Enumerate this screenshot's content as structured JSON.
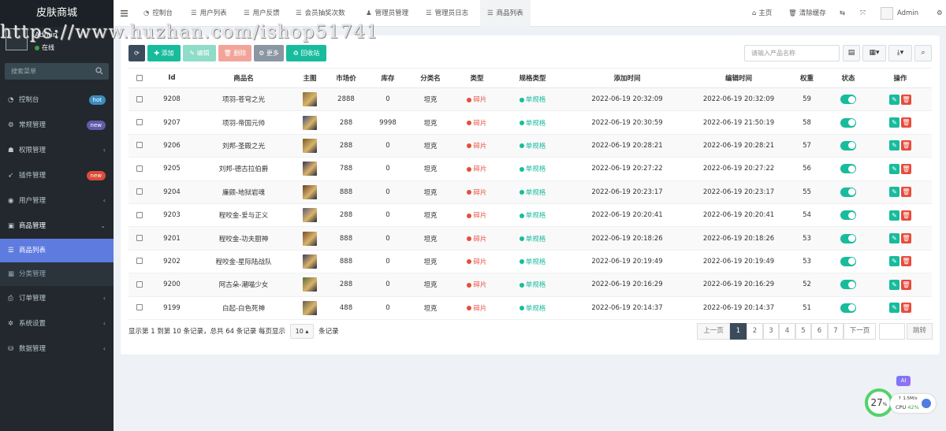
{
  "sidebar": {
    "brand": "皮肤商城",
    "user_name": "Admin",
    "user_status": "在线",
    "search_placeholder": "搜索菜单",
    "menu": [
      {
        "label": "控制台",
        "icon": "dashboard-icon",
        "badge": "hot",
        "badge_color": "#3c8dbc"
      },
      {
        "label": "常规管理",
        "icon": "cogs-icon",
        "badge": "new",
        "badge_color": "#605ca8"
      },
      {
        "label": "权限管理",
        "icon": "group-icon",
        "arrow": "‹"
      },
      {
        "label": "插件管理",
        "icon": "rocket-icon",
        "badge": "new",
        "badge_color": "#dd4b39"
      },
      {
        "label": "用户管理",
        "icon": "user-circle-icon",
        "arrow": "‹"
      },
      {
        "label": "商品管理",
        "icon": "cube-icon",
        "arrow": "⌄"
      }
    ],
    "submenu": [
      {
        "label": "商品列表",
        "icon": "list-icon"
      },
      {
        "label": "分类管理",
        "icon": "grid-icon"
      }
    ],
    "menu2": [
      {
        "label": "订单管理",
        "icon": "print-icon",
        "arrow": "‹"
      },
      {
        "label": "系统设置",
        "icon": "gear-icon",
        "arrow": "‹"
      },
      {
        "label": "数据管理",
        "icon": "database-icon",
        "arrow": "‹"
      }
    ]
  },
  "header": {
    "tabs": [
      "控制台",
      "用户列表",
      "用户反馈",
      "会员抽奖次数",
      "管理员管理",
      "管理员日志",
      "商品列表"
    ],
    "active_tab": 6,
    "home": "主页",
    "clear_cache": "清除缓存",
    "admin": "Admin"
  },
  "toolbar": {
    "add": "添加",
    "edit": "编辑",
    "delete": "删除",
    "more": "更多",
    "recycle": "回收站",
    "search_placeholder": "请输入产品名称"
  },
  "table": {
    "columns": [
      "Id",
      "商品名",
      "主图",
      "市场价",
      "库存",
      "分类名",
      "类型",
      "规格类型",
      "添加时间",
      "编辑时间",
      "权重",
      "状态",
      "操作"
    ],
    "rows": [
      {
        "id": "9208",
        "name": "项羽-苍穹之光",
        "price": "2888",
        "stock": "0",
        "category": "坦克",
        "type": "碎片",
        "spec": "单规格",
        "added": "2022-06-19 20:32:09",
        "edited": "2022-06-19 20:32:09",
        "weight": "59"
      },
      {
        "id": "9207",
        "name": "项羽-帝国元帅",
        "price": "288",
        "stock": "9998",
        "category": "坦克",
        "type": "碎片",
        "spec": "单规格",
        "added": "2022-06-19 20:30:59",
        "edited": "2022-06-19 21:50:19",
        "weight": "58"
      },
      {
        "id": "9206",
        "name": "刘邦-圣殿之光",
        "price": "288",
        "stock": "0",
        "category": "坦克",
        "type": "碎片",
        "spec": "单规格",
        "added": "2022-06-19 20:28:21",
        "edited": "2022-06-19 20:28:21",
        "weight": "57"
      },
      {
        "id": "9205",
        "name": "刘邦-德古拉伯爵",
        "price": "788",
        "stock": "0",
        "category": "坦克",
        "type": "碎片",
        "spec": "单规格",
        "added": "2022-06-19 20:27:22",
        "edited": "2022-06-19 20:27:22",
        "weight": "56"
      },
      {
        "id": "9204",
        "name": "廉颇-地狱岩魂",
        "price": "888",
        "stock": "0",
        "category": "坦克",
        "type": "碎片",
        "spec": "单规格",
        "added": "2022-06-19 20:23:17",
        "edited": "2022-06-19 20:23:17",
        "weight": "55"
      },
      {
        "id": "9203",
        "name": "程咬金-爱与正义",
        "price": "288",
        "stock": "0",
        "category": "坦克",
        "type": "碎片",
        "spec": "单规格",
        "added": "2022-06-19 20:20:41",
        "edited": "2022-06-19 20:20:41",
        "weight": "54"
      },
      {
        "id": "9201",
        "name": "程咬金-功夫厨神",
        "price": "888",
        "stock": "0",
        "category": "坦克",
        "type": "碎片",
        "spec": "单规格",
        "added": "2022-06-19 20:18:26",
        "edited": "2022-06-19 20:18:26",
        "weight": "53"
      },
      {
        "id": "9202",
        "name": "程咬金-星际陆战队",
        "price": "888",
        "stock": "0",
        "category": "坦克",
        "type": "碎片",
        "spec": "单规格",
        "added": "2022-06-19 20:19:49",
        "edited": "2022-06-19 20:19:49",
        "weight": "53"
      },
      {
        "id": "9200",
        "name": "阿古朵-潮喵少女",
        "price": "288",
        "stock": "0",
        "category": "坦克",
        "type": "碎片",
        "spec": "单规格",
        "added": "2022-06-19 20:16:29",
        "edited": "2022-06-19 20:16:29",
        "weight": "52"
      },
      {
        "id": "9199",
        "name": "白起-白色死神",
        "price": "488",
        "stock": "0",
        "category": "坦克",
        "type": "碎片",
        "spec": "单规格",
        "added": "2022-06-19 20:14:37",
        "edited": "2022-06-19 20:14:37",
        "weight": "51"
      }
    ],
    "thumb_colors": [
      "#8a6d3b",
      "#3a4a7a",
      "#7a5a2a",
      "#3b2a5a",
      "#6a3a2a",
      "#5a5a7a",
      "#7a4a2a",
      "#3a3a5a",
      "#5a6a3a",
      "#6a5a4a"
    ]
  },
  "footer": {
    "info_prefix": "显示第 1 到第 10 条记录，总共 64 条记录 每页显示",
    "page_size": "10",
    "info_suffix": "条记录",
    "prev": "上一页",
    "pages": [
      "1",
      "2",
      "3",
      "4",
      "5",
      "6",
      "7"
    ],
    "next": "下一页",
    "jump": "跳转"
  },
  "watermark": "https://www.huzhan.com/ishop51741",
  "widget": {
    "ai": "AI",
    "cpu_percent": "27",
    "percent_sign": "%",
    "net_speed": "1.5M/s",
    "cpu_label": "CPU",
    "cpu_value": "42%"
  }
}
